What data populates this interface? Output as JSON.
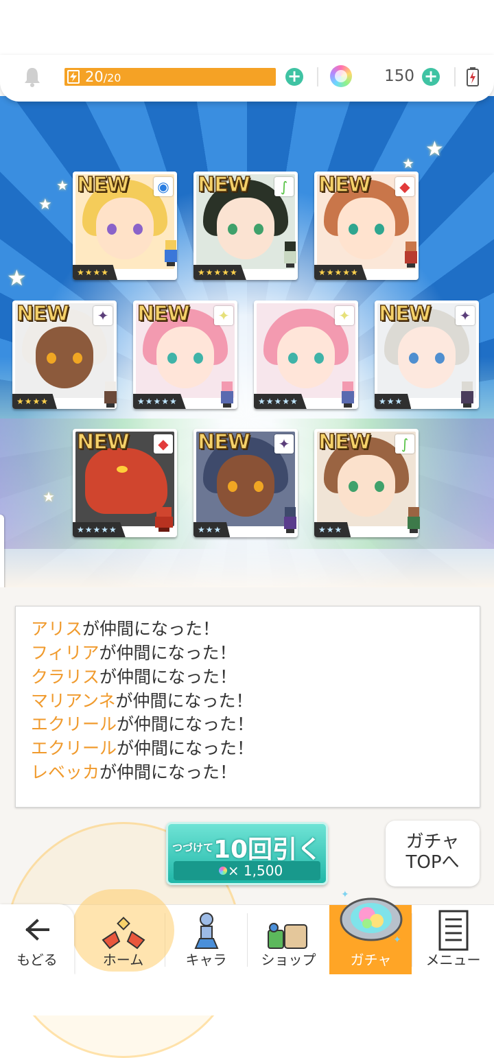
{
  "header": {
    "bell_icon": "bell-icon",
    "stamina_current": "20",
    "stamina_max": "/20",
    "stamina_fraction": 1.0,
    "gem_count": "150",
    "plus_symbol": "+",
    "battery_icon": "battery-charging-icon"
  },
  "cards": [
    {
      "new": "NEW",
      "attr": "water",
      "attr_glyph": "◉",
      "rarity": "★★★★",
      "rarity_color": "gold"
    },
    {
      "new": "NEW",
      "attr": "wind",
      "attr_glyph": "∫",
      "rarity": "★★★★★",
      "rarity_color": "gold"
    },
    {
      "new": "NEW",
      "attr": "fire",
      "attr_glyph": "◆",
      "rarity": "★★★★★",
      "rarity_color": "gold"
    },
    {
      "new": "NEW",
      "attr": "dark",
      "attr_glyph": "✦",
      "rarity": "★★★★",
      "rarity_color": "gold"
    },
    {
      "new": "NEW",
      "attr": "light",
      "attr_glyph": "✦",
      "rarity": "★★★★★",
      "rarity_color": "silver"
    },
    {
      "new": "",
      "attr": "light",
      "attr_glyph": "✦",
      "rarity": "★★★★★",
      "rarity_color": "silver"
    },
    {
      "new": "NEW",
      "attr": "dark",
      "attr_glyph": "✦",
      "rarity": "★★★",
      "rarity_color": "silver"
    },
    {
      "new": "NEW",
      "attr": "fire",
      "attr_glyph": "◆",
      "rarity": "★★★★★",
      "rarity_color": "silver"
    },
    {
      "new": "NEW",
      "attr": "dark",
      "attr_glyph": "✦",
      "rarity": "★★★",
      "rarity_color": "silver"
    },
    {
      "new": "NEW",
      "attr": "wind",
      "attr_glyph": "∫",
      "rarity": "★★★",
      "rarity_color": "silver"
    }
  ],
  "messages": [
    {
      "name": "アリス",
      "suffix": "が仲間になった！"
    },
    {
      "name": "フィリア",
      "suffix": "が仲間になった！"
    },
    {
      "name": "クラリス",
      "suffix": "が仲間になった！"
    },
    {
      "name": "マリアンネ",
      "suffix": "が仲間になった！"
    },
    {
      "name": "エクリール",
      "suffix": "が仲間になった！"
    },
    {
      "name": "エクリール",
      "suffix": "が仲間になった！"
    },
    {
      "name": "レベッカ",
      "suffix": "が仲間になった！"
    }
  ],
  "pull_button": {
    "prefix": "つづけて",
    "label": "10回引く",
    "cost": "× 1,500"
  },
  "gacha_top_button": {
    "line1": "ガチャ",
    "line2": "TOPへ"
  },
  "nav": {
    "back": "もどる",
    "home": "ホーム",
    "chara": "キャラ",
    "shop": "ショップ",
    "gacha": "ガチャ",
    "menu": "メニュー",
    "active": "gacha"
  },
  "colors": {
    "accent_orange": "#ffa526",
    "teal": "#3fc3a3",
    "name_orange": "#f09a2c"
  }
}
